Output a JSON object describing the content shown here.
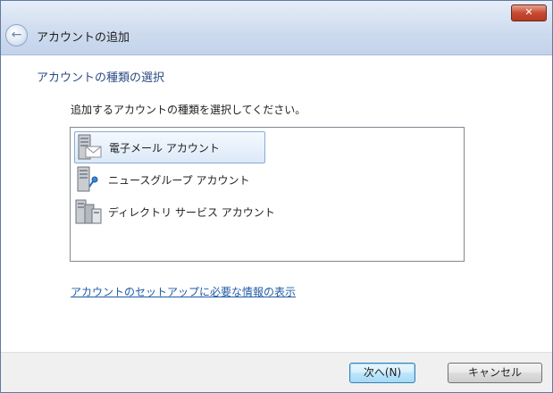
{
  "window": {
    "title": "アカウントの追加",
    "close_label": "✕"
  },
  "page": {
    "section_title": "アカウントの種類の選択",
    "instruction": "追加するアカウントの種類を選択してください。",
    "options": [
      {
        "label": "電子メール アカウント",
        "icon": "email-server-icon",
        "selected": true
      },
      {
        "label": "ニュースグループ アカウント",
        "icon": "newsgroup-server-icon",
        "selected": false
      },
      {
        "label": "ディレクトリ サービス アカウント",
        "icon": "directory-server-icon",
        "selected": false
      }
    ],
    "help_link": "アカウントのセットアップに必要な情報の表示"
  },
  "footer": {
    "next_label": "次へ(N)",
    "cancel_label": "キャンセル"
  }
}
